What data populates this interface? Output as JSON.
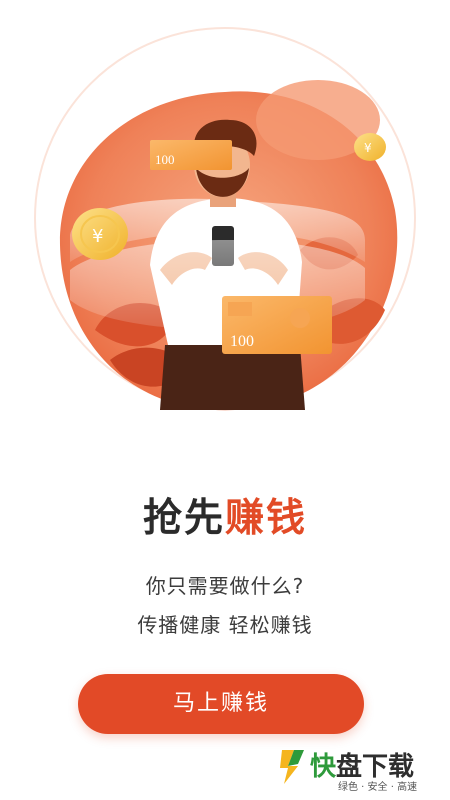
{
  "hero": {
    "bill_top": "100",
    "bill_bottom": "100"
  },
  "headline": {
    "part1": "抢先",
    "part2": "赚钱"
  },
  "subtitle": {
    "line1": "你只需要做什么?",
    "line2": "传播健康 轻松赚钱"
  },
  "cta": {
    "label": "马上赚钱"
  },
  "watermark": {
    "kuai": "快",
    "rest": "盘下载",
    "tagline": "绿色 · 安全 · 高速"
  },
  "colors": {
    "accent": "#e24b26",
    "button": "#e24a27",
    "hero_bg": "#f0895f"
  }
}
